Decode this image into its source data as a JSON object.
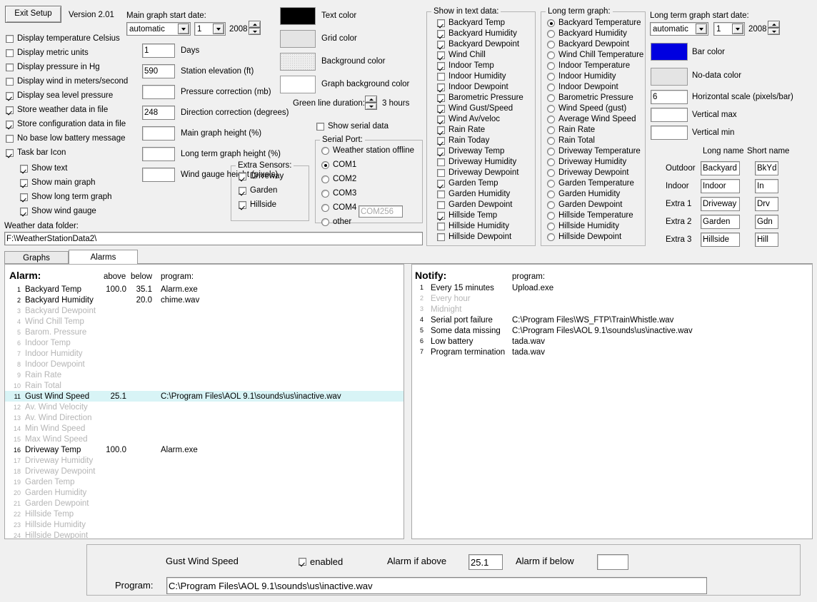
{
  "window": {
    "exit_button": "Exit Setup",
    "version": "Version 2.01"
  },
  "general_options": [
    {
      "label": "Display temperature Celsius",
      "checked": false
    },
    {
      "label": "Display metric units",
      "checked": false
    },
    {
      "label": "Display pressure in Hg",
      "checked": false
    },
    {
      "label": "Display wind in meters/second",
      "checked": false
    },
    {
      "label": "Display sea level pressure",
      "checked": true
    },
    {
      "label": "Store weather data in file",
      "checked": true
    },
    {
      "label": "Store configuration data in file",
      "checked": true
    },
    {
      "label": "No base low battery message",
      "checked": false
    },
    {
      "label": "Task bar Icon",
      "checked": true
    }
  ],
  "taskbar_sub_options": [
    {
      "label": "Show text",
      "checked": true
    },
    {
      "label": "Show main graph",
      "checked": true
    },
    {
      "label": "Show long term graph",
      "checked": true
    },
    {
      "label": "Show wind gauge",
      "checked": true
    }
  ],
  "weather_folder": {
    "label": "Weather data folder:",
    "value": "F:\\WeatherStationData2\\"
  },
  "main_graph": {
    "start_date_label": "Main graph start date:",
    "month_value": "automatic",
    "day_value": "1",
    "year_value": "2008",
    "fields": [
      {
        "value": "1",
        "label": "Days"
      },
      {
        "value": "590",
        "label": "Station elevation (ft)"
      },
      {
        "value": "",
        "label": "Pressure correction (mb)"
      },
      {
        "value": "248",
        "label": "Direction correction (degrees)"
      },
      {
        "value": "",
        "label": "Main graph height (%)"
      },
      {
        "value": "",
        "label": "Long term graph height (%)"
      },
      {
        "value": "",
        "label": "Wind gauge height (pixels)"
      }
    ]
  },
  "colors": [
    {
      "label": "Text color",
      "hex": "#000000",
      "kind": "solid"
    },
    {
      "label": "Grid color",
      "hex": "#e4e4e4",
      "kind": "solid"
    },
    {
      "label": "Background color",
      "hex": "#ededed",
      "kind": "dither"
    },
    {
      "label": "Graph background color",
      "hex": "#ffffff",
      "kind": "solid"
    }
  ],
  "green_line": {
    "label": "Green line duration:",
    "value": "3 hours"
  },
  "show_serial_data": {
    "label": "Show serial data",
    "checked": false
  },
  "extra_sensors": {
    "title": "Extra Sensors:",
    "items": [
      {
        "label": "Driveway",
        "checked": true
      },
      {
        "label": "Garden",
        "checked": true
      },
      {
        "label": "Hillside",
        "checked": true
      }
    ]
  },
  "serial_port": {
    "title": "Serial Port:",
    "options": [
      {
        "label": "Weather station offline",
        "selected": false
      },
      {
        "label": "COM1",
        "selected": true
      },
      {
        "label": "COM2",
        "selected": false
      },
      {
        "label": "COM3",
        "selected": false
      },
      {
        "label": "COM4",
        "selected": false
      },
      {
        "label": "other",
        "selected": false
      }
    ],
    "other_placeholder": "COM256",
    "other_value": ""
  },
  "show_in_text_data": {
    "title": "Show in text data:",
    "items": [
      {
        "label": "Backyard Temp",
        "checked": true
      },
      {
        "label": "Backyard Humidity",
        "checked": true
      },
      {
        "label": "Backyard Dewpoint",
        "checked": true
      },
      {
        "label": "Wind Chill",
        "checked": true
      },
      {
        "label": "Indoor Temp",
        "checked": true
      },
      {
        "label": "Indoor Humidity",
        "checked": false
      },
      {
        "label": "Indoor Dewpoint",
        "checked": true
      },
      {
        "label": "Barometric Pressure",
        "checked": true
      },
      {
        "label": "Wind Gust/Speed",
        "checked": true
      },
      {
        "label": "Wind Av/veloc",
        "checked": true
      },
      {
        "label": "Rain Rate",
        "checked": true
      },
      {
        "label": "Rain Today",
        "checked": true
      },
      {
        "label": "Driveway Temp",
        "checked": true
      },
      {
        "label": "Driveway Humidity",
        "checked": false
      },
      {
        "label": "Driveway Dewpoint",
        "checked": false
      },
      {
        "label": "Garden Temp",
        "checked": true
      },
      {
        "label": "Garden Humidity",
        "checked": false
      },
      {
        "label": "Garden Dewpoint",
        "checked": false
      },
      {
        "label": "Hillside Temp",
        "checked": true
      },
      {
        "label": "Hillside Humidity",
        "checked": false
      },
      {
        "label": "Hillside Dewpoint",
        "checked": false
      }
    ]
  },
  "long_term_graph": {
    "title": "Long term graph:",
    "items": [
      {
        "label": "Backyard Temperature",
        "selected": true
      },
      {
        "label": "Backyard Humidity",
        "selected": false
      },
      {
        "label": "Backyard Dewpoint",
        "selected": false
      },
      {
        "label": "Wind Chill Temperature",
        "selected": false
      },
      {
        "label": "Indoor Temperature",
        "selected": false
      },
      {
        "label": "Indoor Humidity",
        "selected": false
      },
      {
        "label": "Indoor Dewpoint",
        "selected": false
      },
      {
        "label": "Barometric Pressure",
        "selected": false
      },
      {
        "label": "Wind Speed (gust)",
        "selected": false
      },
      {
        "label": "Average Wind Speed",
        "selected": false
      },
      {
        "label": "Rain Rate",
        "selected": false
      },
      {
        "label": "Rain Total",
        "selected": false
      },
      {
        "label": "Driveway Temperature",
        "selected": false
      },
      {
        "label": "Driveway Humidity",
        "selected": false
      },
      {
        "label": "Driveway Dewpoint",
        "selected": false
      },
      {
        "label": "Garden Temperature",
        "selected": false
      },
      {
        "label": "Garden Humidity",
        "selected": false
      },
      {
        "label": "Garden Dewpoint",
        "selected": false
      },
      {
        "label": "Hillside Temperature",
        "selected": false
      },
      {
        "label": "Hillside Humidity",
        "selected": false
      },
      {
        "label": "Hillside Dewpoint",
        "selected": false
      }
    ]
  },
  "long_term_settings": {
    "start_date_label": "Long term graph start date:",
    "month_value": "automatic",
    "day_value": "1",
    "year_value": "2008",
    "bar_color": {
      "label": "Bar color",
      "hex": "#0000e0"
    },
    "nodata_color": {
      "label": "No-data color",
      "hex": "#e4e4e4"
    },
    "fields": [
      {
        "value": "6",
        "label": "Horizontal scale (pixels/bar)"
      },
      {
        "value": "",
        "label": "Vertical max"
      },
      {
        "value": "",
        "label": "Vertical min"
      }
    ]
  },
  "names": {
    "long_header": "Long name",
    "short_header": "Short name",
    "rows": [
      {
        "row": "Outdoor",
        "long": "Backyard",
        "short": "BkYd"
      },
      {
        "row": "Indoor",
        "long": "Indoor",
        "short": "In"
      },
      {
        "row": "Extra 1",
        "long": "Driveway",
        "short": "Drv"
      },
      {
        "row": "Extra 2",
        "long": "Garden",
        "short": "Gdn"
      },
      {
        "row": "Extra 3",
        "long": "Hillside",
        "short": "Hill"
      }
    ]
  },
  "tabs": [
    {
      "label": "Graphs",
      "active": false
    },
    {
      "label": "Alarms",
      "active": true
    }
  ],
  "alarm_panel": {
    "title": "Alarm:",
    "col_above": "above",
    "col_below": "below",
    "col_program": "program:",
    "rows": [
      {
        "n": "1",
        "name": "Backyard Temp",
        "above": "100.0",
        "below": "35.1",
        "program": "Alarm.exe",
        "active": true,
        "selected": false
      },
      {
        "n": "2",
        "name": "Backyard Humidity",
        "above": "",
        "below": "20.0",
        "program": "chime.wav",
        "active": true,
        "selected": false
      },
      {
        "n": "3",
        "name": "Backyard Dewpoint",
        "above": "",
        "below": "",
        "program": "",
        "active": false,
        "selected": false
      },
      {
        "n": "4",
        "name": "Wind Chill Temp",
        "above": "",
        "below": "",
        "program": "",
        "active": false,
        "selected": false
      },
      {
        "n": "5",
        "name": "Barom. Pressure",
        "above": "",
        "below": "",
        "program": "",
        "active": false,
        "selected": false
      },
      {
        "n": "6",
        "name": "Indoor Temp",
        "above": "",
        "below": "",
        "program": "",
        "active": false,
        "selected": false
      },
      {
        "n": "7",
        "name": "Indoor Humidity",
        "above": "",
        "below": "",
        "program": "",
        "active": false,
        "selected": false
      },
      {
        "n": "8",
        "name": "Indoor Dewpoint",
        "above": "",
        "below": "",
        "program": "",
        "active": false,
        "selected": false
      },
      {
        "n": "9",
        "name": "Rain Rate",
        "above": "",
        "below": "",
        "program": "",
        "active": false,
        "selected": false
      },
      {
        "n": "10",
        "name": "Rain Total",
        "above": "",
        "below": "",
        "program": "",
        "active": false,
        "selected": false
      },
      {
        "n": "11",
        "name": "Gust Wind Speed",
        "above": "25.1",
        "below": "",
        "program": "C:\\Program Files\\AOL 9.1\\sounds\\us\\inactive.wav",
        "active": true,
        "selected": true
      },
      {
        "n": "12",
        "name": "Av. Wind Velocity",
        "above": "",
        "below": "",
        "program": "",
        "active": false,
        "selected": false
      },
      {
        "n": "13",
        "name": "Av. Wind Direction",
        "above": "",
        "below": "",
        "program": "",
        "active": false,
        "selected": false
      },
      {
        "n": "14",
        "name": "Min Wind Speed",
        "above": "",
        "below": "",
        "program": "",
        "active": false,
        "selected": false
      },
      {
        "n": "15",
        "name": "Max Wind Speed",
        "above": "",
        "below": "",
        "program": "",
        "active": false,
        "selected": false
      },
      {
        "n": "16",
        "name": "Driveway Temp",
        "above": "100.0",
        "below": "",
        "program": "Alarm.exe",
        "active": true,
        "selected": false
      },
      {
        "n": "17",
        "name": "Driveway Humidity",
        "above": "",
        "below": "",
        "program": "",
        "active": false,
        "selected": false
      },
      {
        "n": "18",
        "name": "Driveway Dewpoint",
        "above": "",
        "below": "",
        "program": "",
        "active": false,
        "selected": false
      },
      {
        "n": "19",
        "name": "Garden Temp",
        "above": "",
        "below": "",
        "program": "",
        "active": false,
        "selected": false
      },
      {
        "n": "20",
        "name": "Garden Humidity",
        "above": "",
        "below": "",
        "program": "",
        "active": false,
        "selected": false
      },
      {
        "n": "21",
        "name": "Garden Dewpoint",
        "above": "",
        "below": "",
        "program": "",
        "active": false,
        "selected": false
      },
      {
        "n": "22",
        "name": "Hillside Temp",
        "above": "",
        "below": "",
        "program": "",
        "active": false,
        "selected": false
      },
      {
        "n": "23",
        "name": "Hillside Humidity",
        "above": "",
        "below": "",
        "program": "",
        "active": false,
        "selected": false
      },
      {
        "n": "24",
        "name": "Hillside Dewpoint",
        "above": "",
        "below": "",
        "program": "",
        "active": false,
        "selected": false
      }
    ]
  },
  "notify_panel": {
    "title": "Notify:",
    "col_program": "program:",
    "rows": [
      {
        "n": "1",
        "name": "Every 15 minutes",
        "program": "Upload.exe",
        "active": true
      },
      {
        "n": "2",
        "name": "Every hour",
        "program": "",
        "active": false
      },
      {
        "n": "3",
        "name": "Midnight",
        "program": "",
        "active": false
      },
      {
        "n": "4",
        "name": "Serial port failure",
        "program": "C:\\Program Files\\WS_FTP\\TrainWhistle.wav",
        "active": true
      },
      {
        "n": "5",
        "name": "Some data missing",
        "program": "C:\\Program Files\\AOL 9.1\\sounds\\us\\inactive.wav",
        "active": true
      },
      {
        "n": "6",
        "name": "Low battery",
        "program": "tada.wav",
        "active": true
      },
      {
        "n": "7",
        "name": "Program termination",
        "program": "tada.wav",
        "active": true
      }
    ]
  },
  "editor": {
    "item_name": "Gust Wind Speed",
    "enabled_label": "enabled",
    "enabled": true,
    "above_label": "Alarm if above",
    "above_value": "25.1",
    "below_label": "Alarm if below",
    "below_value": "",
    "program_label": "Program:",
    "program_value": "C:\\Program Files\\AOL 9.1\\sounds\\us\\inactive.wav"
  }
}
